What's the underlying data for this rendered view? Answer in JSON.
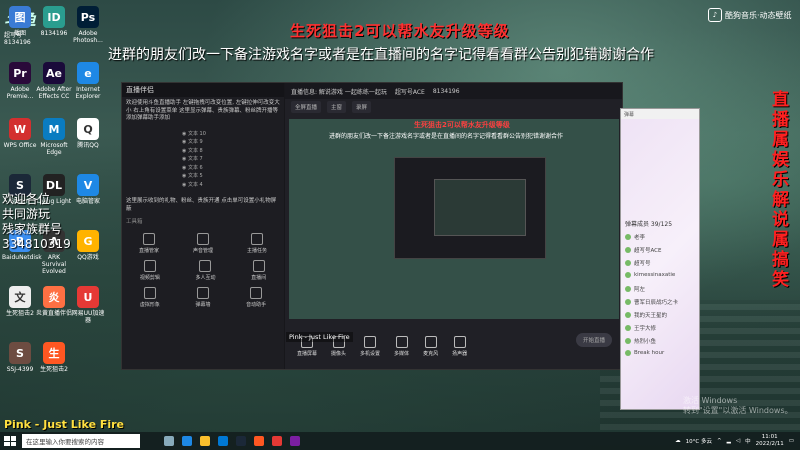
{
  "overlay": {
    "title_red": "生死狙击2可以帮水友升级等级",
    "notice": "进群的朋友们改一下备注游戏名字或者是在直播间的名字记得看看群公告别犯错谢谢合作",
    "vertical": "直播属娱乐解说属搞笑",
    "left_welcome": "欢迎各位",
    "left_line2": "共同游玩",
    "left_line3": "残家族群号",
    "left_group": "334810319",
    "song": "Pink - Just Like Fire",
    "brand": "酷狗音乐·动态壁纸",
    "logo_text": "斗鱼",
    "logo_sub": "超写号",
    "logo_id": "8134196"
  },
  "desktop_icons": [
    {
      "label": "截图",
      "color": "#3a7bd5",
      "glyph": "图"
    },
    {
      "label": "8134196",
      "color": "#2a9d8f",
      "glyph": "ID"
    },
    {
      "label": "Adobe Photosh...",
      "color": "#001e36",
      "glyph": "Ps"
    },
    {
      "label": "Adobe Premie...",
      "color": "#2a0a3a",
      "glyph": "Pr"
    },
    {
      "label": "Adobe After Effects CC",
      "color": "#1a0a3a",
      "glyph": "Ae"
    },
    {
      "label": "Internet Explorer",
      "color": "#1e88e5",
      "glyph": "e"
    },
    {
      "label": "WPS Office",
      "color": "#d32f2f",
      "glyph": "W"
    },
    {
      "label": "Microsoft Edge",
      "color": "#0a7cc1",
      "glyph": "M"
    },
    {
      "label": "腾讯QQ",
      "color": "#ffffff",
      "glyph": "Q"
    },
    {
      "label": "Steam",
      "color": "#1b2838",
      "glyph": "S"
    },
    {
      "label": "Dying Light",
      "color": "#222222",
      "glyph": "DL"
    },
    {
      "label": "电脑管家",
      "color": "#1e88e5",
      "glyph": "V"
    },
    {
      "label": "BaiduNetdisk",
      "color": "#3b8ef0",
      "glyph": "B"
    },
    {
      "label": "ARK Survival Evolved",
      "color": "#333333",
      "glyph": "A"
    },
    {
      "label": "QQ游戏",
      "color": "#ffb300",
      "glyph": "G"
    },
    {
      "label": "生死狙击2",
      "color": "#eeeeee",
      "glyph": "文"
    },
    {
      "label": "炎黄直播伴侣",
      "color": "#ff7043",
      "glyph": "炎"
    },
    {
      "label": "网易UU加速器",
      "color": "#e53935",
      "glyph": "U"
    },
    {
      "label": "SSJ-4399",
      "color": "#6d4c41",
      "glyph": "S"
    },
    {
      "label": "生死狙击2",
      "color": "#ff5722",
      "glyph": "生"
    }
  ],
  "live_window": {
    "app_name": "直播伴侣",
    "hint": "欢迎使用斗鱼直播助手 左键拖拽可改变位置, 左键拉伸可改变大小 右上角有设置菜单 这里显示弹幕、贵族弹幕、粉丝牌开播等 添加弹幕助手添加",
    "hint2": "这里展示收到的礼物、粉丝、贵族开通 点击单可设置小礼物屏蔽",
    "scenes": [
      "文本 10",
      "文本 9",
      "文本 8",
      "文本 7",
      "文本 6",
      "文本 5",
      "文本 4"
    ],
    "scene_label": "工具箱",
    "tools_top": [
      "直播管家",
      "声音管理",
      "主播任务"
    ],
    "tools_mid": [
      "视频剪辑",
      "多人互动",
      "直播间"
    ],
    "tools_bottom": [
      "虚拟形象",
      "弹幕墙",
      "音动助手"
    ],
    "top_title": "直播信息: 解说游戏 一起练练一起玩",
    "top_user": "超写号ACE",
    "top_id": "8134196",
    "tabs": [
      "全屏直播",
      "主窗",
      "录屏"
    ],
    "bottom_buttons": [
      "直播屏幕",
      "摄像头",
      "多机设置",
      "多媒体",
      "麦克风",
      "扬声器"
    ],
    "start_label": "开始直播",
    "music": "Pink - Just Like Fire",
    "preview_text": "进群的朋友们改一下备注游戏名字或者是在直播间的名字记得看看群公告别犯错谢谢合作",
    "preview_red": "生死狙击2可以帮水友升级等级"
  },
  "chat_window": {
    "title": "弹幕",
    "header": "弹幕成员 39/125",
    "lines": [
      "老李",
      "超写号ACE",
      "超写号",
      "kimessinaxatie",
      "阿左",
      "曹军日辰战巧之卡",
      "我的天王星的",
      "王宇大修",
      "热烈小鱼",
      "Break hour"
    ]
  },
  "taskbar": {
    "search_placeholder": "在这里输入你要搜索的内容",
    "weather": "10°C 多云",
    "time": "11:01",
    "date": "2022/2/11",
    "lang": "中"
  },
  "watermark": {
    "line1": "激活 Windows",
    "line2": "转到\"设置\"以激活 Windows。"
  }
}
